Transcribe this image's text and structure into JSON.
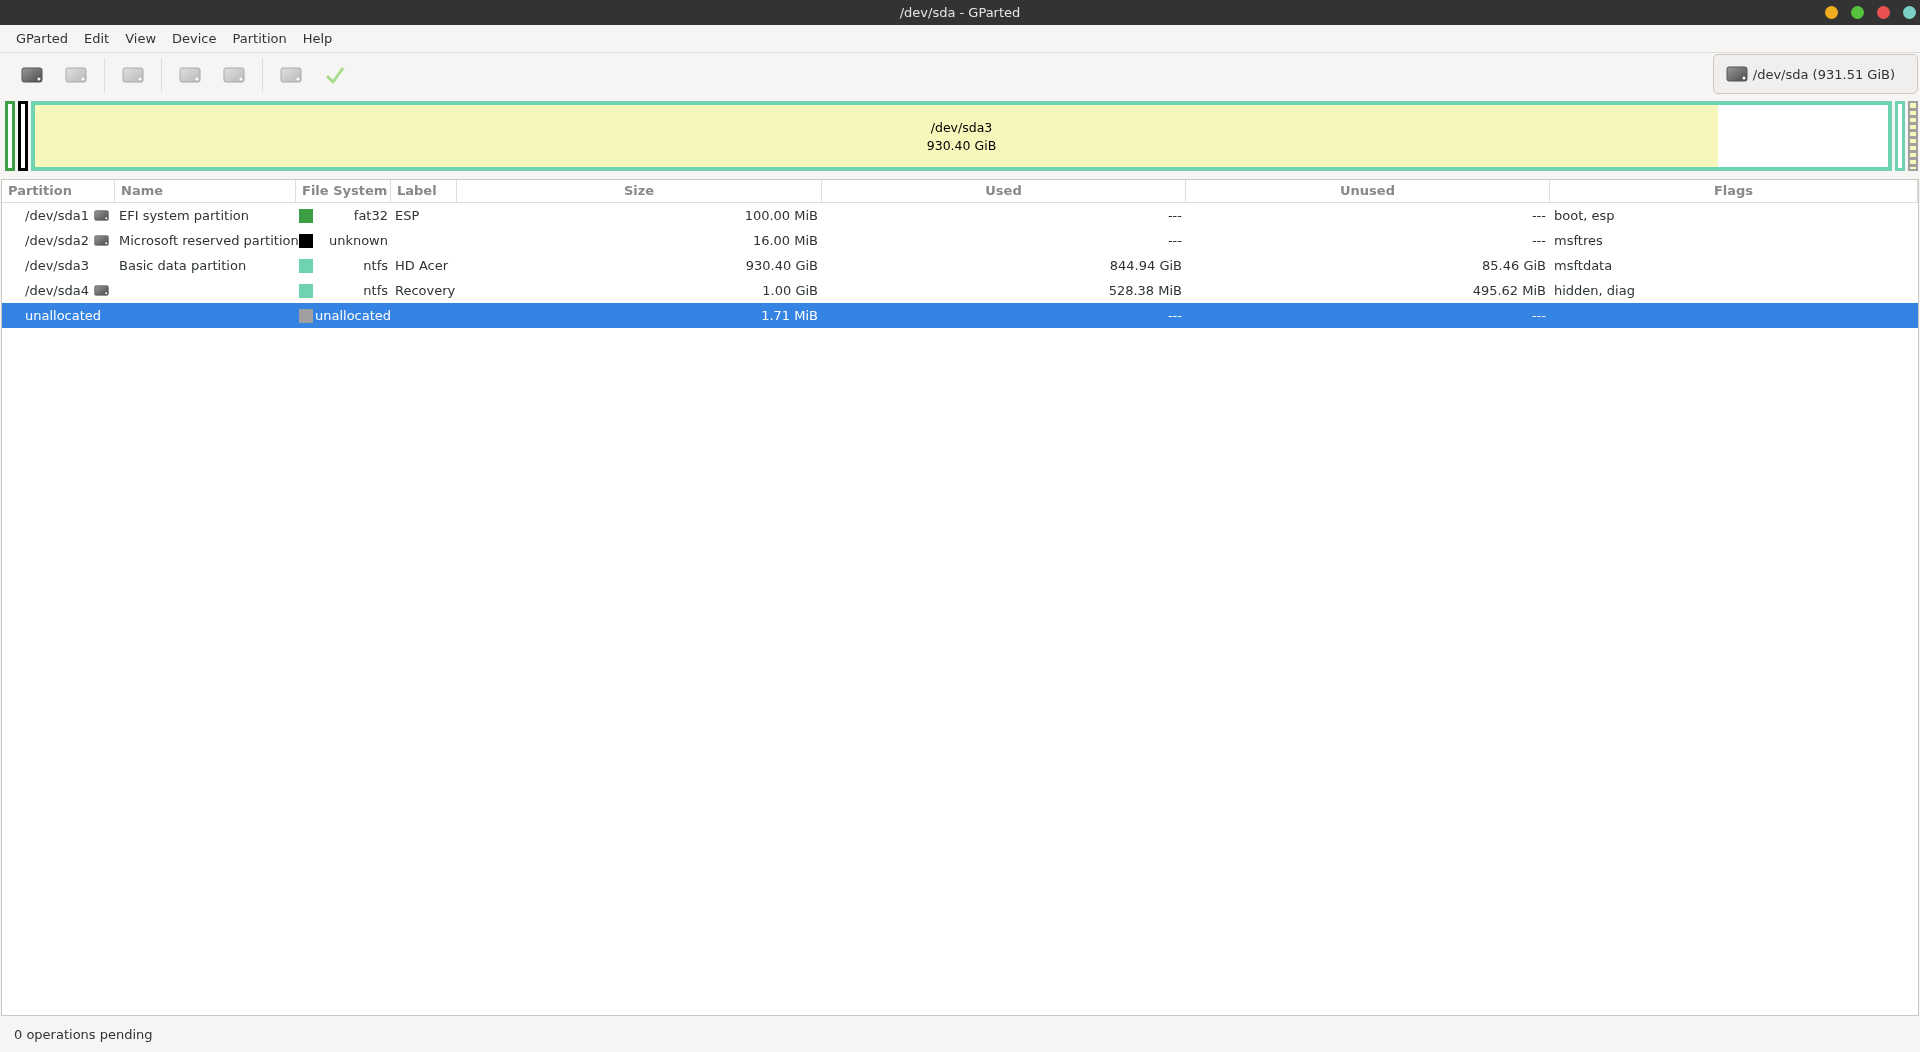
{
  "window": {
    "title": "/dev/sda - GParted",
    "controls": [
      {
        "color": "#f0ad1e"
      },
      {
        "color": "#55c43c"
      },
      {
        "color": "#ea5251"
      },
      {
        "color": "#7bd1c6"
      }
    ]
  },
  "menu": [
    "GParted",
    "Edit",
    "View",
    "Device",
    "Partition",
    "Help"
  ],
  "toolbar": [
    {
      "kind": "drive",
      "disabled": false
    },
    {
      "kind": "drive",
      "disabled": true
    },
    {
      "kind": "separator"
    },
    {
      "kind": "drive",
      "disabled": true
    },
    {
      "kind": "separator"
    },
    {
      "kind": "drive",
      "disabled": true
    },
    {
      "kind": "drive",
      "disabled": true
    },
    {
      "kind": "separator"
    },
    {
      "kind": "drive",
      "disabled": true
    },
    {
      "kind": "apply",
      "disabled": true
    }
  ],
  "device_selector": {
    "label": "/dev/sda (931.51 GiB)"
  },
  "disk_map": [
    {
      "kind": "partition",
      "color": "#3e9e45"
    },
    {
      "kind": "partition",
      "color": "#000000"
    },
    {
      "kind": "partition",
      "color": "#6fd2b0",
      "name": "/dev/sda3",
      "size": "930.40 GiB",
      "level": 0.908
    },
    {
      "kind": "partition",
      "color": "#6fd2b0"
    },
    {
      "kind": "unallocated",
      "color": "#a0a0a0"
    }
  ],
  "table": {
    "columns": [
      "Partition",
      "Name",
      "File System",
      "Label",
      "Size",
      "Used",
      "Unused",
      "Flags"
    ],
    "rows": [
      {
        "partition": "/dev/sda1",
        "icon": true,
        "name": "EFI system partition",
        "color": "#3e9e45",
        "file_system": "fat32",
        "label": "ESP",
        "size": "100.00 MiB",
        "used": "---",
        "unused": "---",
        "flags": "boot, esp",
        "selected": false
      },
      {
        "partition": "/dev/sda2",
        "icon": true,
        "name": "Microsoft reserved partition",
        "color": "#000000",
        "file_system": "unknown",
        "label": "",
        "size": "16.00 MiB",
        "used": "---",
        "unused": "---",
        "flags": "msftres",
        "selected": false
      },
      {
        "partition": "/dev/sda3",
        "icon": false,
        "name": "Basic data partition",
        "color": "#6fd2b0",
        "file_system": "ntfs",
        "label": "HD Acer",
        "size": "930.40 GiB",
        "used": "844.94 GiB",
        "unused": "85.46 GiB",
        "flags": "msftdata",
        "selected": false
      },
      {
        "partition": "/dev/sda4",
        "icon": true,
        "name": "",
        "color": "#6fd2b0",
        "file_system": "ntfs",
        "label": "Recovery",
        "size": "1.00 GiB",
        "used": "528.38 MiB",
        "unused": "495.62 MiB",
        "flags": "hidden, diag",
        "selected": false
      },
      {
        "partition": "unallocated",
        "icon": false,
        "name": "",
        "color": "#a0a0a0",
        "file_system": "unallocated",
        "label": "",
        "size": "1.71 MiB",
        "used": "---",
        "unused": "---",
        "flags": "",
        "selected": true
      }
    ]
  },
  "status_bar": {
    "text": "0 operations pending"
  }
}
